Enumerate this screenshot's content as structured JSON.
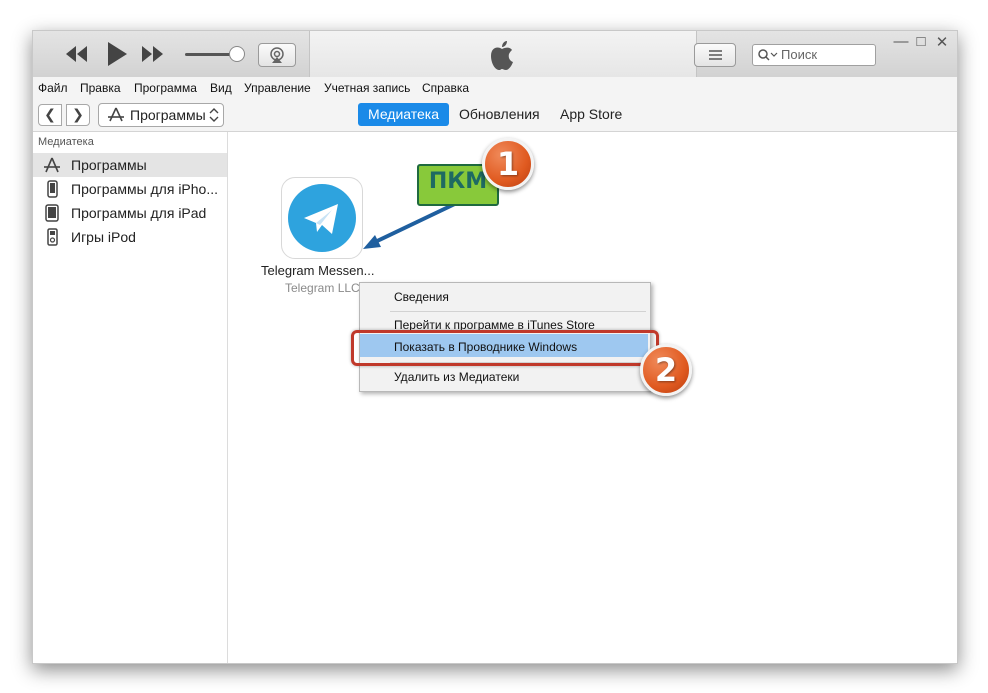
{
  "titlebar": {
    "search_placeholder": "Поиск",
    "accent": "#1a8ae8"
  },
  "menu": {
    "items": [
      "Файл",
      "Правка",
      "Программа",
      "Вид",
      "Управление",
      "Учетная запись",
      "Справка"
    ]
  },
  "nav": {
    "dropdown_label": "Программы",
    "tabs": [
      {
        "label": "Медиатека",
        "active": true
      },
      {
        "label": "Обновления",
        "active": false
      },
      {
        "label": "App Store",
        "active": false
      }
    ]
  },
  "sidebar": {
    "heading": "Медиатека",
    "items": [
      {
        "label": "Программы",
        "icon": "app-store-icon",
        "selected": true
      },
      {
        "label": "Программы для iPho...",
        "icon": "iphone-icon",
        "selected": false
      },
      {
        "label": "Программы для iPad",
        "icon": "ipad-icon",
        "selected": false
      },
      {
        "label": "Игры iPod",
        "icon": "ipod-icon",
        "selected": false
      }
    ]
  },
  "app": {
    "name": "Telegram Messen...",
    "developer": "Telegram LLC",
    "icon": "telegram-icon"
  },
  "context_menu": {
    "items": [
      "Сведения",
      "Перейти к программе в iTunes Store",
      "Показать в Проводнике Windows",
      "Удалить из Медиатеки"
    ],
    "highlight_color": "#9ec8f0"
  },
  "annotations": {
    "pkm_label": "ПКМ",
    "step1": "1",
    "step2": "2",
    "badge_color": "#e05a20",
    "arrow_color": "#1f5f9f"
  }
}
